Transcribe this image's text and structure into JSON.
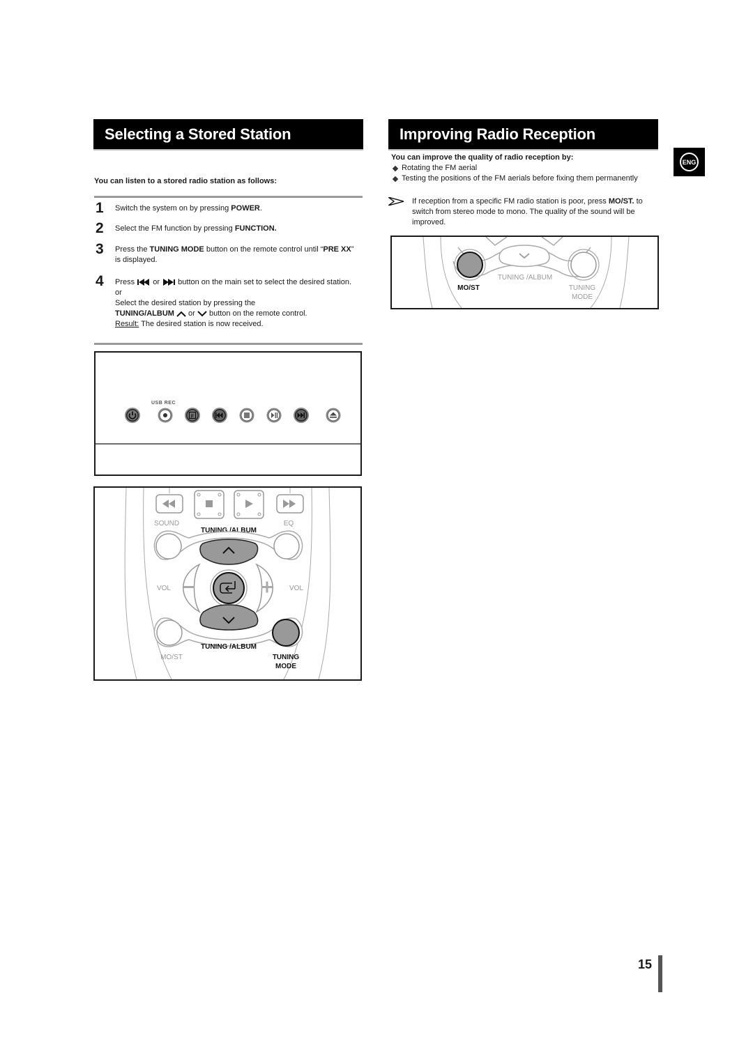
{
  "left": {
    "title": "Selecting a Stored Station",
    "intro": "You can listen to a stored radio station as follows:",
    "steps": [
      {
        "num": "1",
        "pre": "Switch the system on by pressing ",
        "bold": "POWER",
        "post": "."
      },
      {
        "num": "2",
        "pre": "Select the FM function by pressing ",
        "bold": "FUNCTION.",
        "post": ""
      },
      {
        "num": "3",
        "pre": "Press the ",
        "bold": "TUNING MODE",
        "mid": " button on the remote control  until “",
        "bold2": "PRE XX",
        "post": "” is displayed."
      },
      {
        "num": "4",
        "line1_pre": "Press ",
        "line1_or": " or ",
        "line1_post": " button on the main set to select the desired station. or",
        "line2": "Select the desired station by pressing the",
        "line3_bold": "TUNING/ALBUM",
        "line3_or": " or ",
        "line3_post": " button on the remote control.",
        "result_label": "Result:",
        "result_text": " The desired station is now received."
      }
    ]
  },
  "main_set": {
    "usb_rec_label": "USB REC",
    "buttons": [
      "power-icon",
      "record-icon",
      "function-icon",
      "skip-back-icon",
      "stop-icon",
      "play-pause-icon",
      "skip-forward-icon",
      "eject-icon"
    ],
    "function_glyph": "F"
  },
  "remote": {
    "sound": "SOUND",
    "eq": "EQ",
    "tuning_album_top": "TUNING /ALBUM",
    "tuning_album_bottom": "TUNING /ALBUM",
    "vol_left": "VOL",
    "vol_right": "VOL",
    "most": "MO/ST",
    "tuning": "TUNING",
    "mode": "MODE"
  },
  "right": {
    "title": "Improving Radio Reception",
    "intro": "You can improve the quality of radio reception by:",
    "bullets": [
      "Rotating the FM aerial",
      "Testing the positions of the FM aerials before fixing them permanently"
    ],
    "note_pre": "If reception from a specific FM radio station is poor, press ",
    "note_bold": "MO/ST.",
    "note_post": " to switch from stereo mode to mono. The quality of the sound will be improved.",
    "remote_detail": {
      "most": "MO/ST",
      "tuning_album": "TUNING /ALBUM",
      "tuning": "TUNING",
      "mode": "MODE"
    }
  },
  "badge": {
    "lang": "ENG"
  },
  "page_number": "15"
}
